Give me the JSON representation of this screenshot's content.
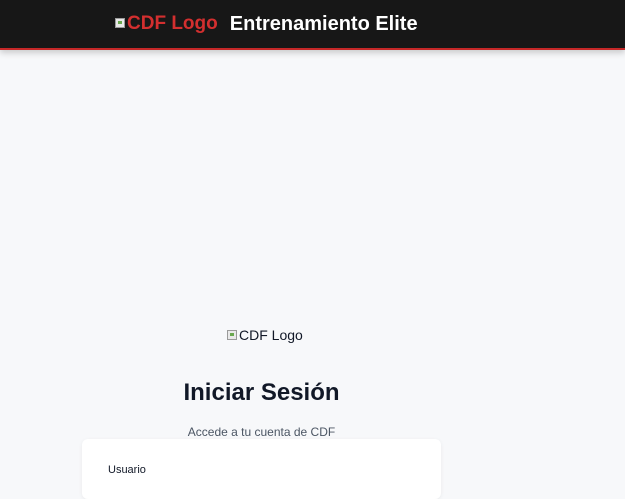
{
  "header": {
    "logo_alt": "CDF Logo",
    "title": "Entrenamiento Elite"
  },
  "login": {
    "logo_alt": "CDF Logo",
    "title": "Iniciar Sesión",
    "subtitle": "Accede a tu cuenta de CDF",
    "username_label": "Usuario"
  },
  "colors": {
    "header_background": "#171717",
    "brand_red": "#d32f2f",
    "page_background": "#f7f8fa",
    "card_background": "#ffffff"
  },
  "icons": {
    "broken_image": "broken-image-icon"
  }
}
